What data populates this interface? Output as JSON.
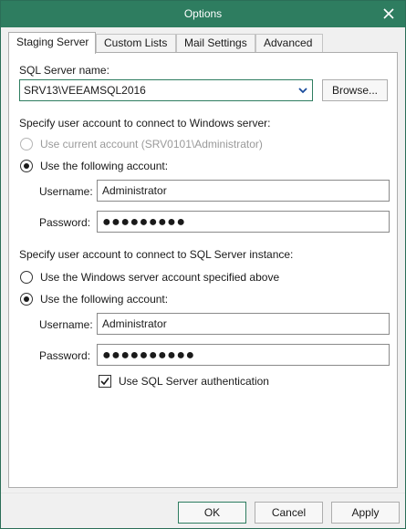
{
  "window": {
    "title": "Options"
  },
  "tabs": [
    {
      "label": "Staging Server",
      "active": true
    },
    {
      "label": "Custom Lists",
      "active": false
    },
    {
      "label": "Mail Settings",
      "active": false
    },
    {
      "label": "Advanced",
      "active": false
    }
  ],
  "sql_server": {
    "label": "SQL Server name:",
    "value": "SRV13\\VEEAMSQL2016",
    "browse_label": "Browse..."
  },
  "windows_account": {
    "heading": "Specify user account to connect to Windows server:",
    "option_current": "Use current account (SRV0101\\Administrator)",
    "option_following": "Use the following account:",
    "selected": "following",
    "username_label": "Username:",
    "username_value": "Administrator",
    "password_label": "Password:",
    "password_mask": "●●●●●●●●●"
  },
  "sql_account": {
    "heading": "Specify user account to connect to SQL Server instance:",
    "option_windows": "Use the Windows server account specified above",
    "option_following": "Use the following account:",
    "selected": "following",
    "username_label": "Username:",
    "username_value": "Administrator",
    "password_label": "Password:",
    "password_mask": "●●●●●●●●●●",
    "sql_auth_label": "Use SQL Server authentication",
    "sql_auth_checked": true
  },
  "footer": {
    "ok_label": "OK",
    "cancel_label": "Cancel",
    "apply_label": "Apply"
  },
  "colors": {
    "titlebar": "#2e7d60",
    "accent_border": "#2e7d60"
  },
  "icons": {
    "close": "close-icon",
    "dropdown": "chevron-down-icon",
    "check": "checkmark-icon"
  }
}
